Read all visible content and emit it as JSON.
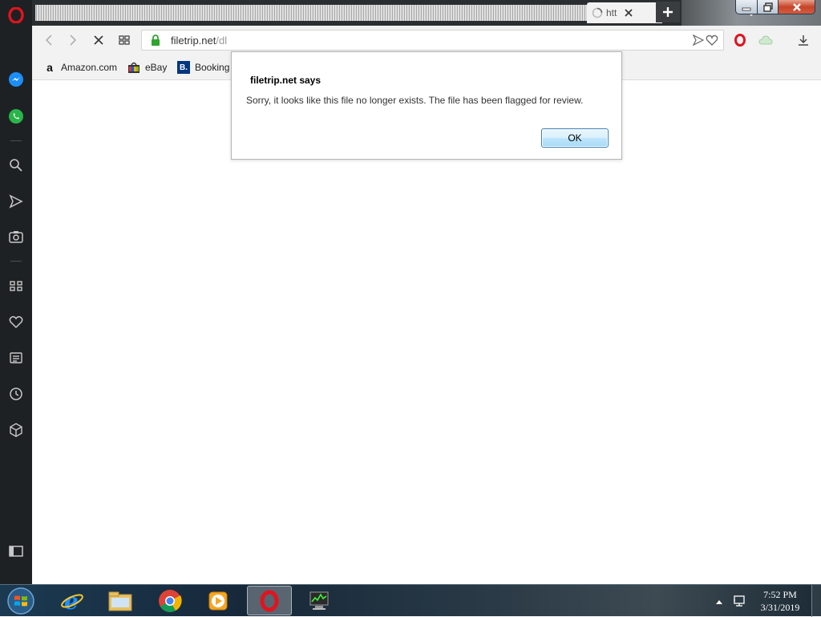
{
  "browser": {
    "tab": {
      "title": "htt"
    },
    "address": {
      "host": "filetrip.net",
      "path": "/dl"
    },
    "bookmarks": [
      {
        "label": "Amazon.com",
        "icon": "a"
      },
      {
        "label": "eBay",
        "icon": ""
      },
      {
        "label": "Booking",
        "icon": "B."
      }
    ]
  },
  "dialog": {
    "title": "filetrip.net says",
    "message": "Sorry, it looks like this file no longer exists. The file has been flagged for review.",
    "ok_label": "OK"
  },
  "taskbar": {
    "time": "7:52 PM",
    "date": "3/31/2019"
  },
  "colors": {
    "opera_red": "#e0141e",
    "sidebar_bg": "#1e2124",
    "secure_green": "#2fa42f"
  }
}
